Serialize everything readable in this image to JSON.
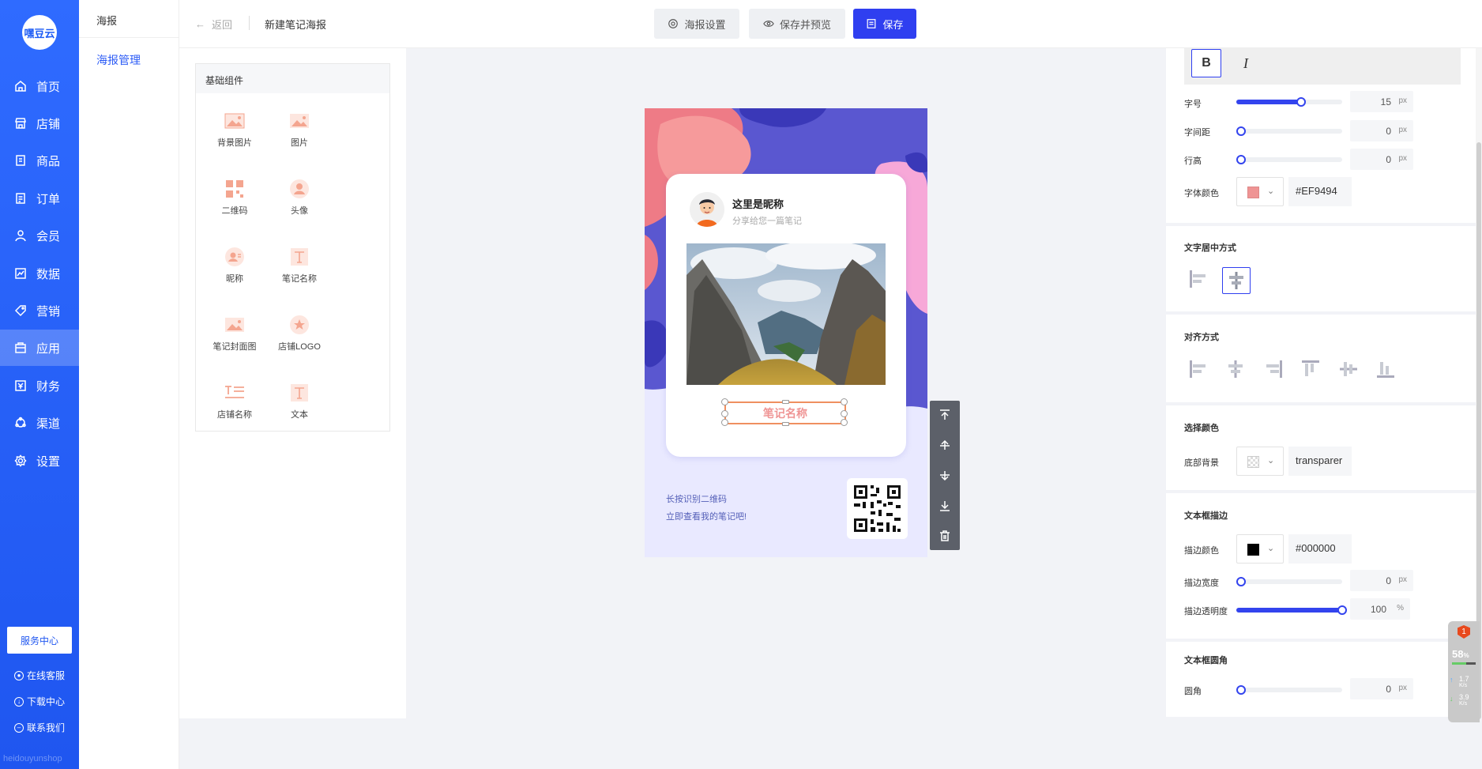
{
  "sidebar": {
    "logo_text": "嘿豆云",
    "items": [
      {
        "label": "首页",
        "icon": "home-icon"
      },
      {
        "label": "店铺",
        "icon": "shop-icon"
      },
      {
        "label": "商品",
        "icon": "goods-icon"
      },
      {
        "label": "订单",
        "icon": "order-icon"
      },
      {
        "label": "会员",
        "icon": "member-icon"
      },
      {
        "label": "数据",
        "icon": "chart-icon"
      },
      {
        "label": "营销",
        "icon": "tag-icon"
      },
      {
        "label": "应用",
        "icon": "app-icon"
      },
      {
        "label": "财务",
        "icon": "finance-icon"
      },
      {
        "label": "渠道",
        "icon": "channel-icon"
      },
      {
        "label": "设置",
        "icon": "gear-icon"
      }
    ],
    "service_center": "服务中心",
    "links": [
      {
        "label": "在线客服"
      },
      {
        "label": "下载中心"
      },
      {
        "label": "联系我们"
      }
    ],
    "footer": "heidouyunshop"
  },
  "subnav": {
    "title": "海报",
    "item": "海报管理"
  },
  "topbar": {
    "back": "返回",
    "crumb": "新建笔记海报",
    "btn_settings": "海报设置",
    "btn_preview": "保存并预览",
    "btn_save": "保存"
  },
  "components": {
    "header": "基础组件",
    "items": [
      "背景图片",
      "图片",
      "二维码",
      "头像",
      "昵称",
      "笔记名称",
      "笔记封面图",
      "店铺LOGO",
      "店铺名称",
      "文本"
    ]
  },
  "poster": {
    "nickname": "这里是昵称",
    "subtitle": "分享给您一篇笔记",
    "note_name": "笔记名称",
    "cta_line1": "长按识别二维码",
    "cta_line2": "立即查看我的笔记吧!"
  },
  "props": {
    "bold": "B",
    "italic": "I",
    "font_size_label": "字号",
    "font_size": "15",
    "letter_spacing_label": "字间距",
    "letter_spacing": "0",
    "line_height_label": "行高",
    "line_height": "0",
    "unit_px": "px",
    "font_color_label": "字体颜色",
    "font_color": "#EF9494",
    "text_align_title": "文字居中方式",
    "align_title": "对齐方式",
    "select_color_title": "选择颜色",
    "bg_label": "底部背景",
    "bg_value": "transparer",
    "stroke_title": "文本框描边",
    "stroke_color_label": "描边颜色",
    "stroke_color": "#000000",
    "stroke_width_label": "描边宽度",
    "stroke_width": "0",
    "stroke_opacity_label": "描边透明度",
    "stroke_opacity": "100",
    "unit_pct": "%",
    "radius_title": "文本框圆角",
    "radius_label": "圆角",
    "radius": "0",
    "font_size_level": 0.61,
    "stroke_opacity_level": 1.0
  },
  "monitor": {
    "badge": "1",
    "percent": "58",
    "up": "1.7",
    "down": "3.9",
    "unit": "K/s"
  },
  "colors": {
    "accent": "#2f3ff0",
    "sidebar": "#1f56f0",
    "font_color": "#EF9494"
  }
}
